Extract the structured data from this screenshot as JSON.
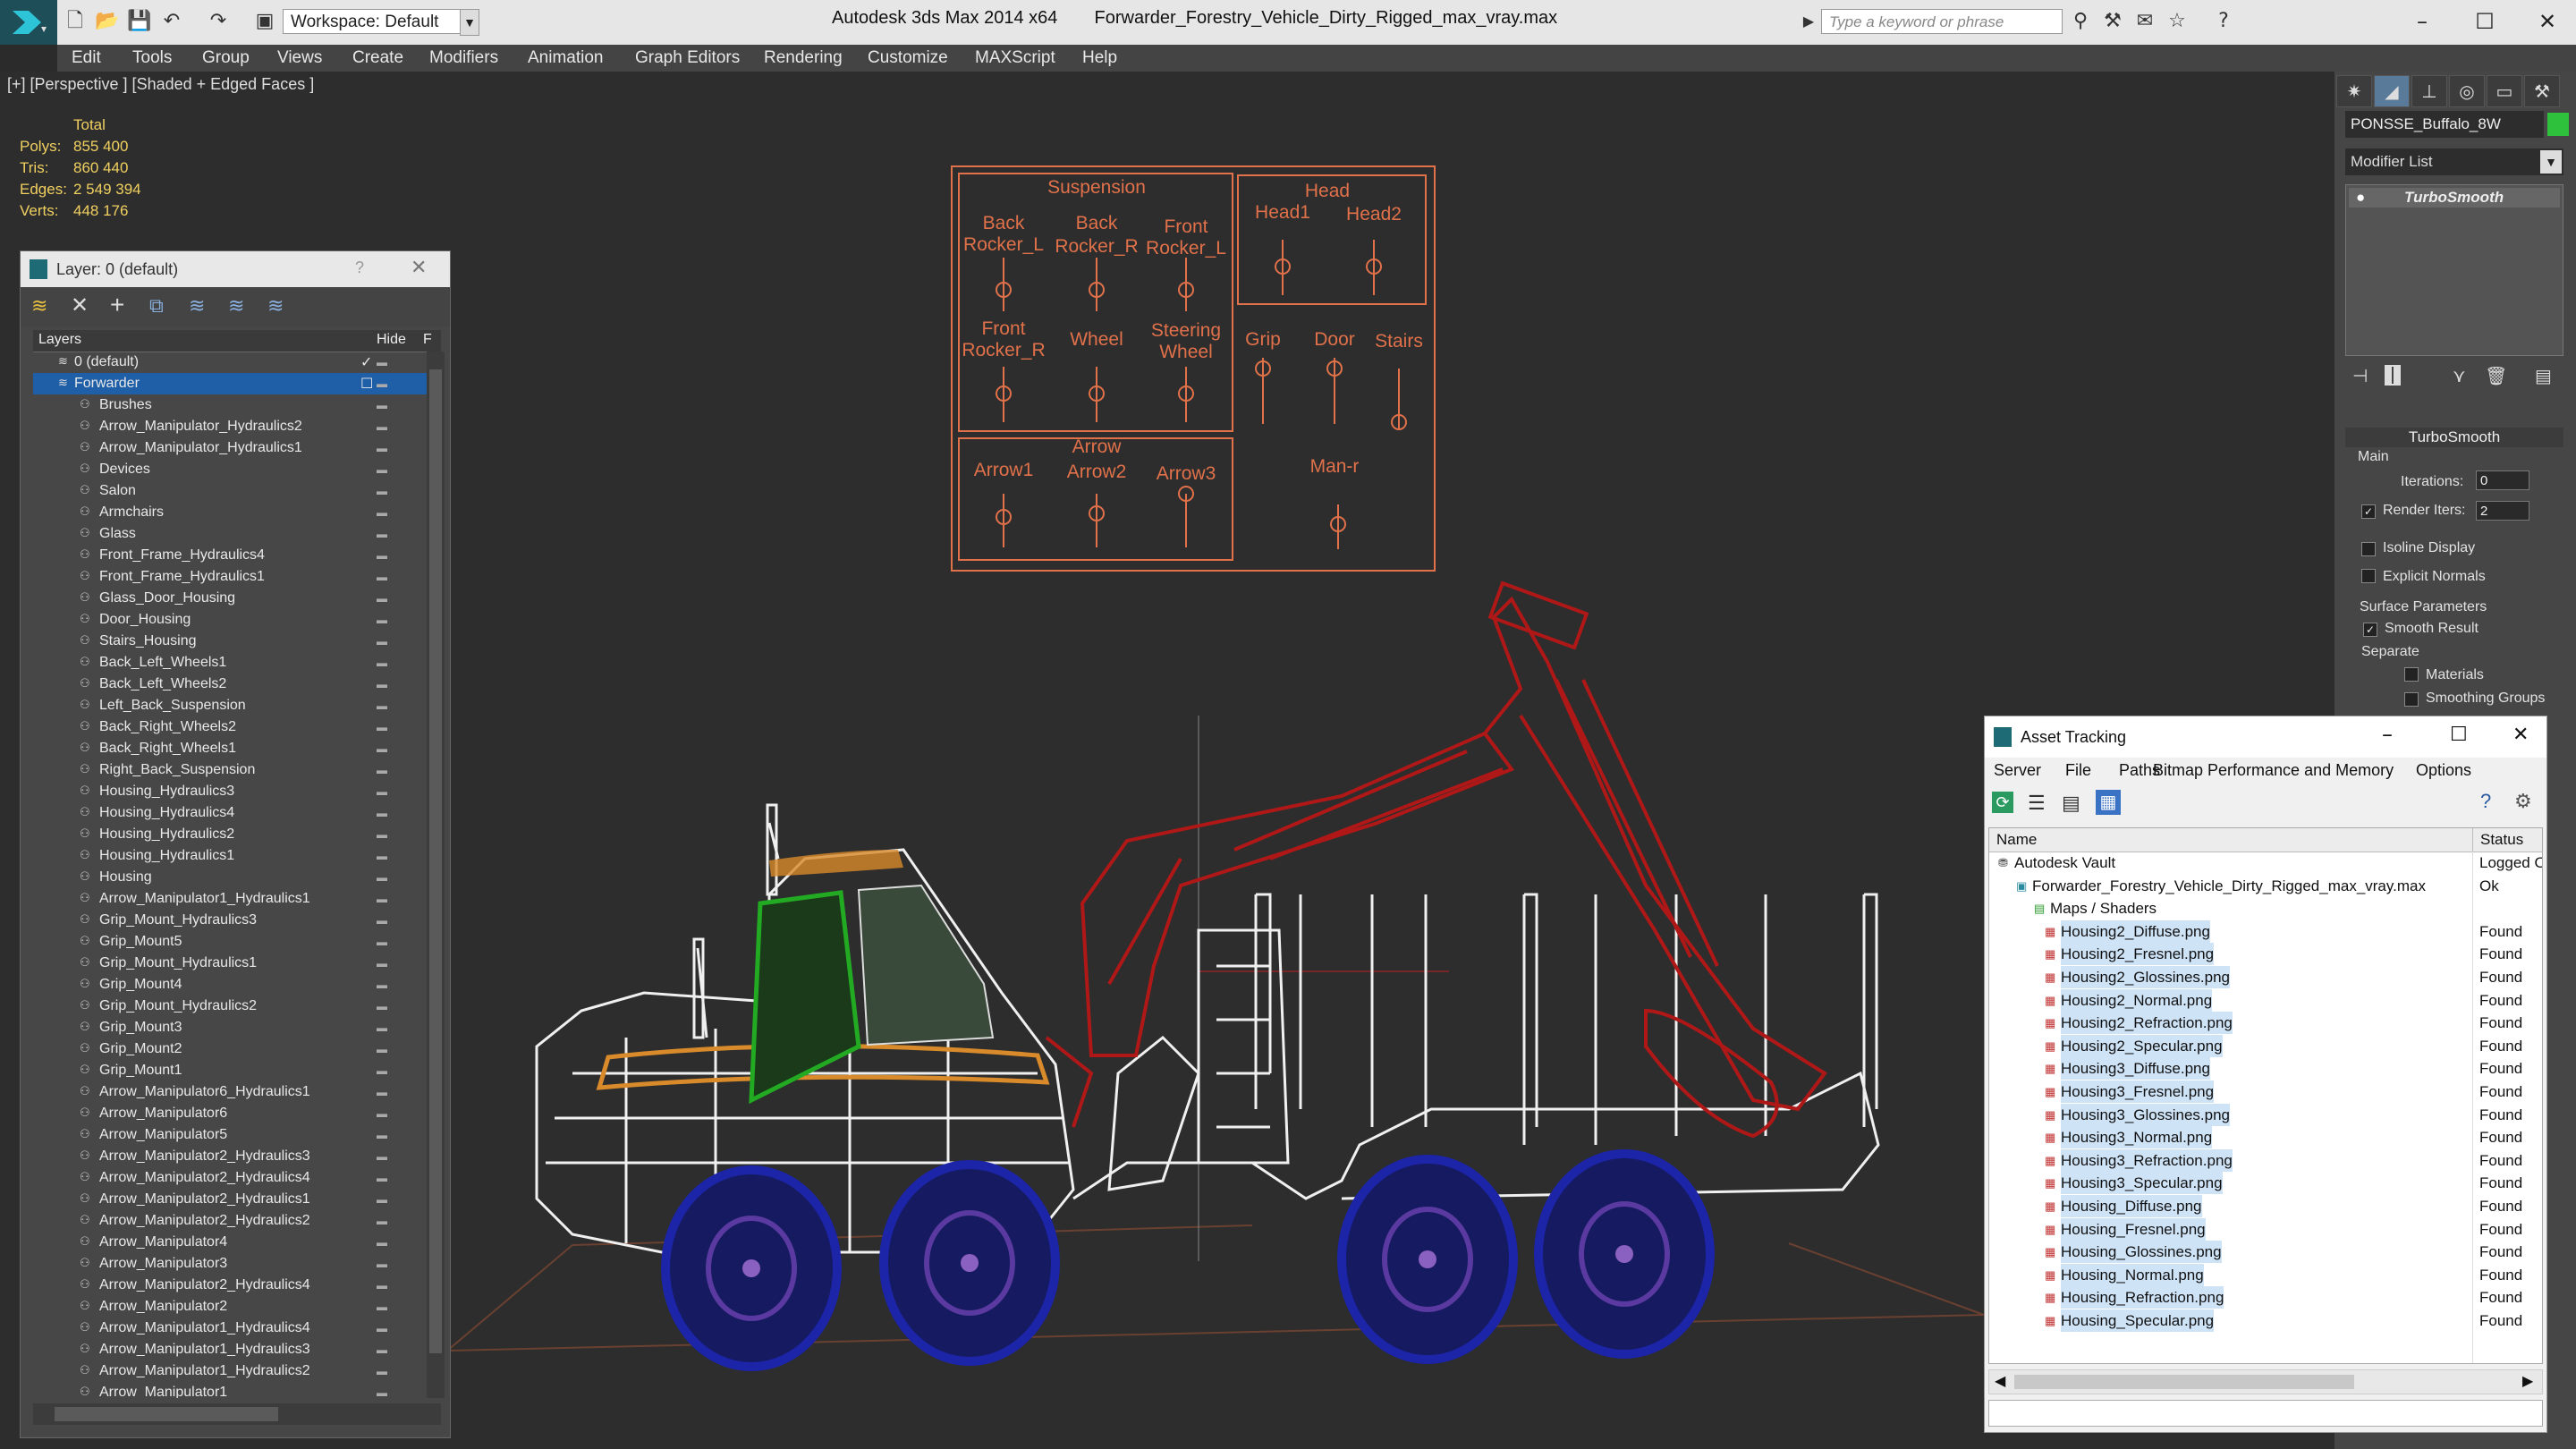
{
  "app": {
    "title": "Autodesk 3ds Max  2014 x64",
    "file": "Forwarder_Forestry_Vehicle_Dirty_Rigged_max_vray.max",
    "workspace": "Workspace: Default",
    "search_placeholder": "Type a keyword or phrase"
  },
  "menu": [
    "Edit",
    "Tools",
    "Group",
    "Views",
    "Create",
    "Modifiers",
    "Animation",
    "Graph Editors",
    "Rendering",
    "Customize",
    "MAXScript",
    "Help"
  ],
  "viewport": {
    "label": "[+] [Perspective ] [Shaded + Edged Faces ]",
    "stats": {
      "header": "Total",
      "rows": [
        {
          "label": "Polys:",
          "value": "855 400"
        },
        {
          "label": "Tris:",
          "value": "860 440"
        },
        {
          "label": "Edges:",
          "value": "2 549 394"
        },
        {
          "label": "Verts:",
          "value": "448 176"
        }
      ]
    },
    "rig": {
      "suspension_title": "Suspension",
      "head_title": "Head",
      "labels": [
        "Back\nRocker_L",
        "Back\nRocker_R",
        "Front\nRocker_L",
        "Front\nRocker_R",
        "Wheel",
        "Steering\nWheel",
        "Head1",
        "Head2",
        "Grip",
        "Door",
        "Stairs",
        "Arrow1",
        "Arrow\nArrow2",
        "Arrow3",
        "Man-r"
      ]
    },
    "colors": {
      "rig": "#e0714a",
      "boom": "#b01818",
      "wheels": "#1c24a8",
      "cab": "#22aa22",
      "stripe": "#d98a2a"
    }
  },
  "layer_panel": {
    "title": "Layer: 0 (default)",
    "help": "?",
    "columns": {
      "name": "Layers",
      "hide": "Hide",
      "freeze": "F"
    },
    "rows": [
      {
        "name": "0 (default)",
        "level": 0,
        "checked": true
      },
      {
        "name": "Forwarder",
        "level": 0,
        "selected": true
      },
      {
        "name": "Brushes",
        "level": 1
      },
      {
        "name": "Arrow_Manipulator_Hydraulics2",
        "level": 1
      },
      {
        "name": "Arrow_Manipulator_Hydraulics1",
        "level": 1
      },
      {
        "name": "Devices",
        "level": 1
      },
      {
        "name": "Salon",
        "level": 1
      },
      {
        "name": "Armchairs",
        "level": 1
      },
      {
        "name": "Glass",
        "level": 1
      },
      {
        "name": "Front_Frame_Hydraulics4",
        "level": 1
      },
      {
        "name": "Front_Frame_Hydraulics1",
        "level": 1
      },
      {
        "name": "Glass_Door_Housing",
        "level": 1
      },
      {
        "name": "Door_Housing",
        "level": 1
      },
      {
        "name": "Stairs_Housing",
        "level": 1
      },
      {
        "name": "Back_Left_Wheels1",
        "level": 1
      },
      {
        "name": "Back_Left_Wheels2",
        "level": 1
      },
      {
        "name": "Left_Back_Suspension",
        "level": 1
      },
      {
        "name": "Back_Right_Wheels2",
        "level": 1
      },
      {
        "name": "Back_Right_Wheels1",
        "level": 1
      },
      {
        "name": "Right_Back_Suspension",
        "level": 1
      },
      {
        "name": "Housing_Hydraulics3",
        "level": 1
      },
      {
        "name": "Housing_Hydraulics4",
        "level": 1
      },
      {
        "name": "Housing_Hydraulics2",
        "level": 1
      },
      {
        "name": "Housing_Hydraulics1",
        "level": 1
      },
      {
        "name": "Housing",
        "level": 1
      },
      {
        "name": "Arrow_Manipulator1_Hydraulics1",
        "level": 1
      },
      {
        "name": "Grip_Mount_Hydraulics3",
        "level": 1
      },
      {
        "name": "Grip_Mount5",
        "level": 1
      },
      {
        "name": "Grip_Mount_Hydraulics1",
        "level": 1
      },
      {
        "name": "Grip_Mount4",
        "level": 1
      },
      {
        "name": "Grip_Mount_Hydraulics2",
        "level": 1
      },
      {
        "name": "Grip_Mount3",
        "level": 1
      },
      {
        "name": "Grip_Mount2",
        "level": 1
      },
      {
        "name": "Grip_Mount1",
        "level": 1
      },
      {
        "name": "Arrow_Manipulator6_Hydraulics1",
        "level": 1
      },
      {
        "name": "Arrow_Manipulator6",
        "level": 1
      },
      {
        "name": "Arrow_Manipulator5",
        "level": 1
      },
      {
        "name": "Arrow_Manipulator2_Hydraulics3",
        "level": 1
      },
      {
        "name": "Arrow_Manipulator2_Hydraulics4",
        "level": 1
      },
      {
        "name": "Arrow_Manipulator2_Hydraulics1",
        "level": 1
      },
      {
        "name": "Arrow_Manipulator2_Hydraulics2",
        "level": 1
      },
      {
        "name": "Arrow_Manipulator4",
        "level": 1
      },
      {
        "name": "Arrow_Manipulator3",
        "level": 1
      },
      {
        "name": "Arrow_Manipulator2_Hydraulics4",
        "level": 1
      },
      {
        "name": "Arrow_Manipulator2",
        "level": 1
      },
      {
        "name": "Arrow_Manipulator1_Hydraulics4",
        "level": 1
      },
      {
        "name": "Arrow_Manipulator1_Hydraulics3",
        "level": 1
      },
      {
        "name": "Arrow_Manipulator1_Hydraulics2",
        "level": 1
      },
      {
        "name": "Arrow_Manipulator1",
        "level": 1
      }
    ]
  },
  "command_panel": {
    "object_name": "PONSSE_Buffalo_8W",
    "modifier_list": "Modifier List",
    "stack_item": "TurboSmooth",
    "rollout": "TurboSmooth",
    "main": "Main",
    "iterations_label": "Iterations:",
    "iterations_value": "0",
    "render_iters_label": "Render Iters:",
    "render_iters_value": "2",
    "isoline": "Isoline Display",
    "explicit": "Explicit Normals",
    "surface": "Surface Parameters",
    "smooth_result": "Smooth Result",
    "separate": "Separate",
    "materials": "Materials",
    "smoothing_groups": "Smoothing Groups"
  },
  "asset_tracking": {
    "title": "Asset Tracking",
    "menu": [
      "Server",
      "File",
      "Paths",
      "Bitmap Performance and Memory",
      "Options"
    ],
    "columns": {
      "name": "Name",
      "status": "Status"
    },
    "rows": [
      {
        "name": "Autodesk Vault",
        "status": "Logged O",
        "level": 0
      },
      {
        "name": "Forwarder_Forestry_Vehicle_Dirty_Rigged_max_vray.max",
        "status": "Ok",
        "level": 1
      },
      {
        "name": "Maps / Shaders",
        "status": "",
        "level": 2
      },
      {
        "name": "Housing2_Diffuse.png",
        "status": "Found",
        "level": 3
      },
      {
        "name": "Housing2_Fresnel.png",
        "status": "Found",
        "level": 3
      },
      {
        "name": "Housing2_Glossines.png",
        "status": "Found",
        "level": 3
      },
      {
        "name": "Housing2_Normal.png",
        "status": "Found",
        "level": 3
      },
      {
        "name": "Housing2_Refraction.png",
        "status": "Found",
        "level": 3
      },
      {
        "name": "Housing2_Specular.png",
        "status": "Found",
        "level": 3
      },
      {
        "name": "Housing3_Diffuse.png",
        "status": "Found",
        "level": 3
      },
      {
        "name": "Housing3_Fresnel.png",
        "status": "Found",
        "level": 3
      },
      {
        "name": "Housing3_Glossines.png",
        "status": "Found",
        "level": 3
      },
      {
        "name": "Housing3_Normal.png",
        "status": "Found",
        "level": 3
      },
      {
        "name": "Housing3_Refraction.png",
        "status": "Found",
        "level": 3
      },
      {
        "name": "Housing3_Specular.png",
        "status": "Found",
        "level": 3
      },
      {
        "name": "Housing_Diffuse.png",
        "status": "Found",
        "level": 3
      },
      {
        "name": "Housing_Fresnel.png",
        "status": "Found",
        "level": 3
      },
      {
        "name": "Housing_Glossines.png",
        "status": "Found",
        "level": 3
      },
      {
        "name": "Housing_Normal.png",
        "status": "Found",
        "level": 3
      },
      {
        "name": "Housing_Refraction.png",
        "status": "Found",
        "level": 3
      },
      {
        "name": "Housing_Specular.png",
        "status": "Found",
        "level": 3
      }
    ]
  }
}
